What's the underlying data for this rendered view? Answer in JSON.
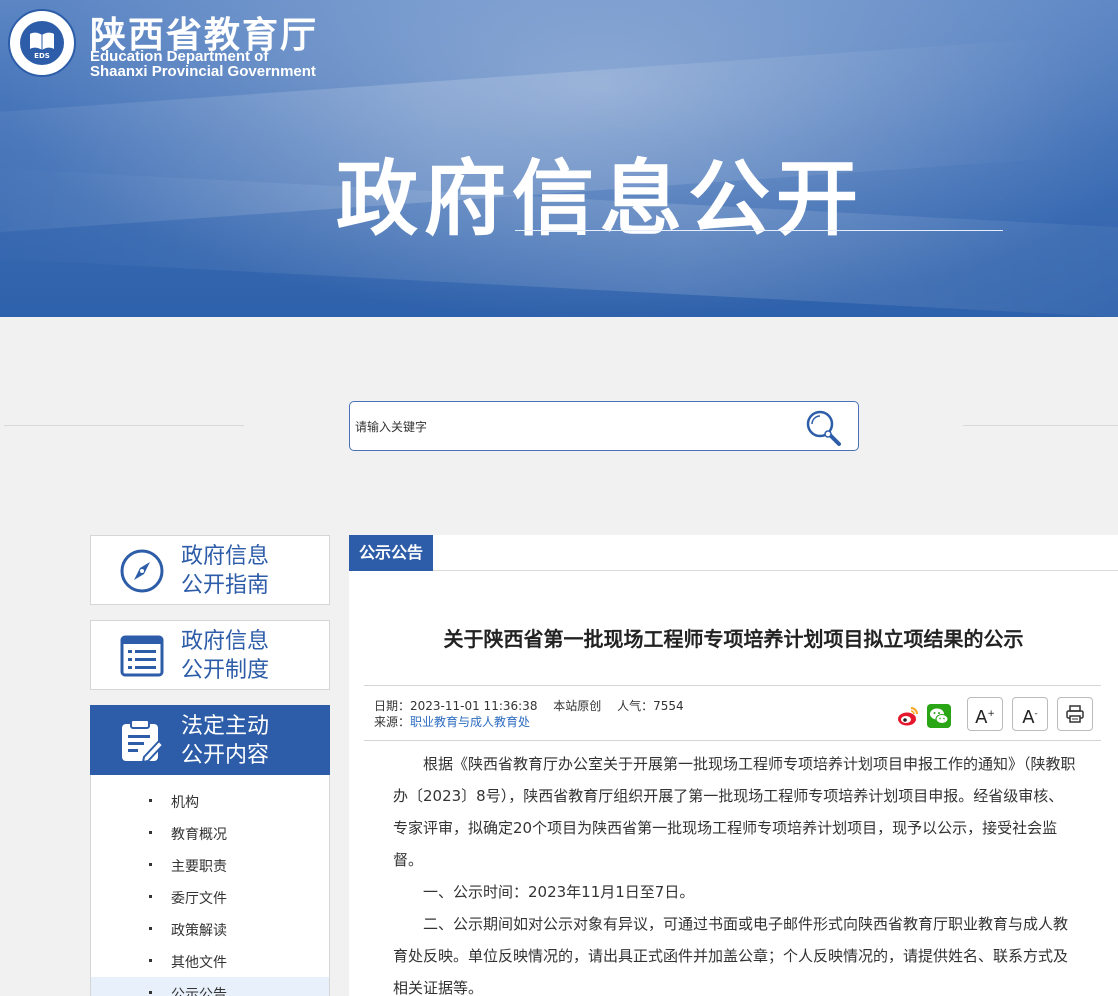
{
  "header": {
    "site_name_cn": "陕西省教育厅",
    "site_name_en_1": "Education Department of",
    "site_name_en_2": "Shaanxi Provincial Government",
    "logo_text": "EDS",
    "banner_title": "政府信息公开"
  },
  "search": {
    "placeholder": "请输入关键字"
  },
  "sidebar": {
    "cards": [
      {
        "line1": "政府信息",
        "line2": "公开指南",
        "icon": "compass-icon"
      },
      {
        "line1": "政府信息",
        "line2": "公开制度",
        "icon": "list-document-icon"
      },
      {
        "line1": "法定主动",
        "line2": "公开内容",
        "icon": "clipboard-edit-icon"
      }
    ],
    "items": [
      "机构",
      "教育概况",
      "主要职责",
      "委厅文件",
      "政策解读",
      "其他文件",
      "公示公告"
    ]
  },
  "main": {
    "tab_label": "公示公告",
    "article_title": "关于陕西省第一批现场工程师专项培养计划项目拟立项结果的公示",
    "meta": {
      "date": "日期：2023-11-01 11:36:38",
      "origin": "本站原创",
      "views": "人气：7554",
      "source_label": "来源：",
      "source_link": "职业教育与成人教育处"
    },
    "tools": {
      "font_larger": "A",
      "font_larger_sup": "+",
      "font_smaller": "A",
      "font_smaller_sup": "-"
    },
    "paragraphs": [
      "根据《陕西省教育厅办公室关于开展第一批现场工程师专项培养计划项目申报工作的通知》（陕教职办〔2023〕8号），陕西省教育厅组织开展了第一批现场工程师专项培养计划项目申报。经省级审核、专家评审，拟确定20个项目为陕西省第一批现场工程师专项培养计划项目，现予以公示，接受社会监督。",
      "一、公示时间：2023年11月1日至7日。",
      "二、公示期间如对公示对象有异议，可通过书面或电子邮件形式向陕西省教育厅职业教育与成人教育处反映。单位反映情况的，请出具正式函件并加盖公章；个人反映情况的，请提供姓名、联系方式及相关证据等。"
    ]
  },
  "colors": {
    "brand_blue": "#2d5da8",
    "link_blue": "#2d6cc0",
    "page_bg": "#f1f1f1"
  }
}
